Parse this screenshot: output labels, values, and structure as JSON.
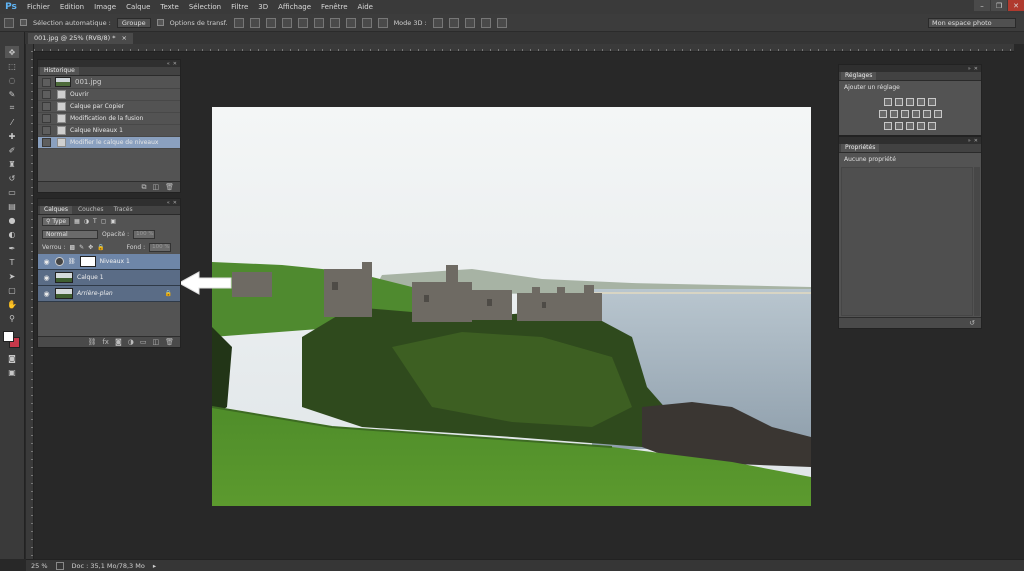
{
  "app": {
    "logo": "Ps"
  },
  "menu": [
    "Fichier",
    "Edition",
    "Image",
    "Calque",
    "Texte",
    "Sélection",
    "Filtre",
    "3D",
    "Affichage",
    "Fenêtre",
    "Aide"
  ],
  "options_bar": {
    "auto_select_label": "Sélection automatique :",
    "auto_select_value": "Groupe",
    "transform_label": "Options de transf.",
    "mode3d_label": "Mode 3D :",
    "workspace": "Mon espace photo"
  },
  "document": {
    "tab_title": "001.jpg @ 25% (RVB/8) *",
    "close": "×"
  },
  "toolbar": {
    "tools": [
      "move-tool",
      "marquee-tool",
      "lasso-tool",
      "quick-select-tool",
      "crop-tool",
      "eyedropper-tool",
      "healing-tool",
      "brush-tool",
      "clone-stamp-tool",
      "history-brush-tool",
      "eraser-tool",
      "gradient-tool",
      "blur-tool",
      "dodge-tool",
      "pen-tool",
      "type-tool",
      "path-select-tool",
      "shape-tool",
      "hand-tool",
      "zoom-tool"
    ],
    "foreground_color": "#ffffff",
    "background_color": "#c8384a"
  },
  "history_panel": {
    "tab": "Historique",
    "snapshot": "001.jpg",
    "steps": [
      "Ouvrir",
      "Calque par Copier",
      "Modification de la fusion",
      "Calque Niveaux 1",
      "Modifier le calque de niveaux"
    ],
    "active_step": 4
  },
  "layers_panel": {
    "tabs": [
      "Calques",
      "Couches",
      "Tracés"
    ],
    "filter_label": "Type",
    "blend_mode": "Normal",
    "opacity_label": "Opacité :",
    "opacity_value": "100 %",
    "lock_label": "Verrou :",
    "fill_label": "Fond :",
    "fill_value": "100 %",
    "layers": [
      {
        "name": "Niveaux 1",
        "type": "adjustment"
      },
      {
        "name": "Calque 1",
        "type": "pixel"
      },
      {
        "name": "Arrière-plan",
        "type": "background",
        "locked": true
      }
    ]
  },
  "adjustments_panel": {
    "tab": "Réglages",
    "title": "Ajouter un réglage"
  },
  "properties_panel": {
    "tab": "Propriétés",
    "message": "Aucune propriété"
  },
  "status_bar": {
    "zoom": "25 %",
    "doc_info": "Doc : 35,1 Mo/78,3 Mo"
  },
  "colors": {
    "accent_selection": "#6e86a8",
    "chrome": "#3a3a3a",
    "panel": "#535353"
  }
}
